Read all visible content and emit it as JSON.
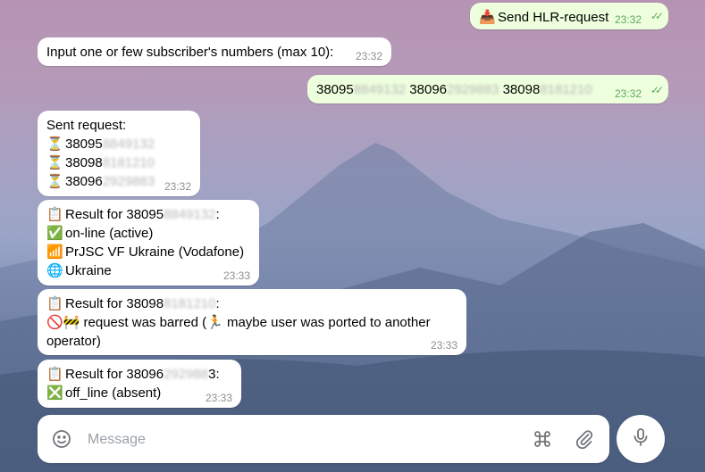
{
  "messages": {
    "m1": {
      "icon": "📥",
      "text": "Send HLR-request",
      "time": "23:32",
      "status": "✓✓"
    },
    "m2": {
      "text": "Input one or few subscriber's numbers (max 10):",
      "time": "23:32"
    },
    "m3": {
      "n1a": "38095",
      "n1b": "8849132",
      "n2a": "38096",
      "n2b": "2929883",
      "n3a": "38098",
      "n3b": "8181210",
      "time": "23:32",
      "status": "✓✓"
    },
    "m4": {
      "title": "Sent request:",
      "lines": [
        {
          "icon": "⏳",
          "a": "38095",
          "b": "8849132"
        },
        {
          "icon": "⏳",
          "a": "38098",
          "b": "8181210"
        },
        {
          "icon": "⏳",
          "a": "38096",
          "b": "2929883"
        }
      ],
      "time": "23:32"
    },
    "m5": {
      "icon": "📋",
      "prefix": "Result for ",
      "a": "38095",
      "b": "8849132",
      "suffix": ":",
      "l2_icon": "✅",
      "l2": "on-line (active)",
      "l3_icon": "📶",
      "l3": "PrJSC VF Ukraine (Vodafone)",
      "l4_icon": "🌐",
      "l4": "Ukraine",
      "time": "23:33"
    },
    "m6": {
      "icon": "📋",
      "prefix": "Result for ",
      "a": "38098",
      "b": "8181210",
      "suffix": ":",
      "l2_icons": "🚫🚧",
      "l2a": "request was barred (",
      "l2_icon2": "🏃",
      "l2b": "maybe user was ported to another",
      "l3": "operator)",
      "time": "23:33"
    },
    "m7": {
      "icon": "📋",
      "prefix": "Result for ",
      "a": "38096",
      "b": "292988",
      "suffix": "3:",
      "l2_icon": "❎",
      "l2": "off_line (absent)",
      "time": "23:33"
    }
  },
  "composer": {
    "placeholder": "Message",
    "emoji_icon": "smile-icon",
    "commands_icon": "command-icon",
    "attach_icon": "paperclip-icon",
    "mic_icon": "microphone-icon"
  },
  "colors": {
    "incoming": "#ffffff",
    "outgoing": "#eeffde",
    "accent": "#3390ec",
    "time_out": "#5fa960"
  }
}
